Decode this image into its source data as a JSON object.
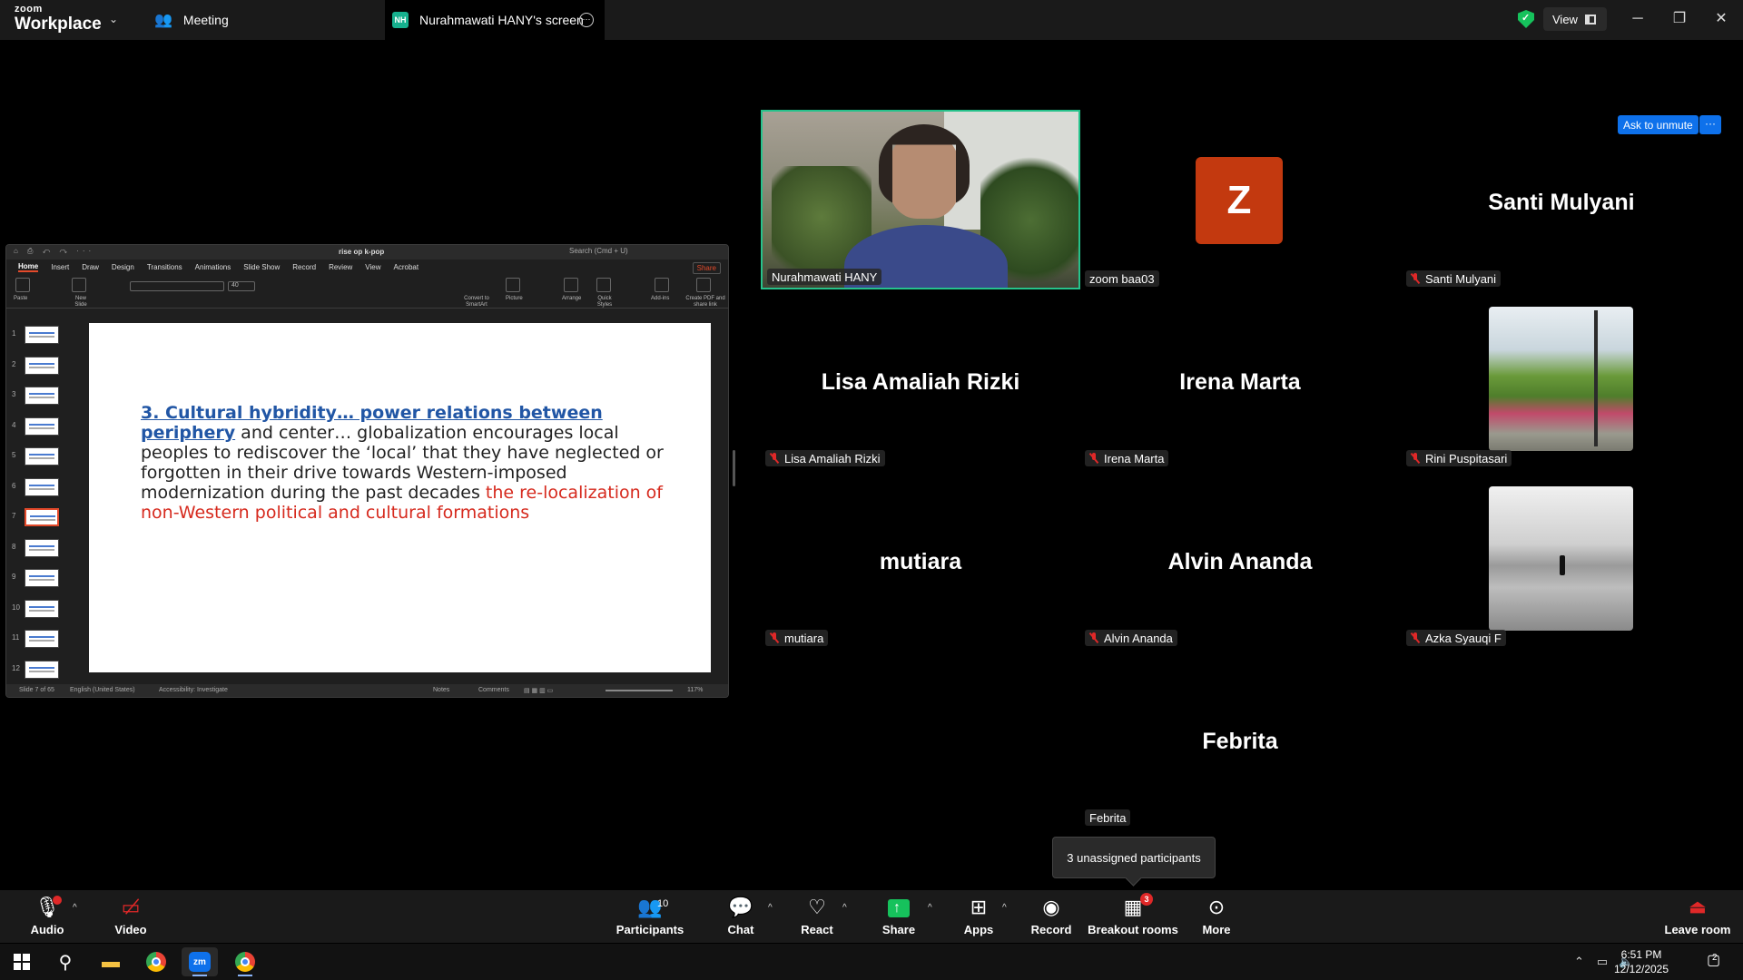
{
  "app": {
    "logo_line1": "zoom",
    "logo_line2": "Workplace",
    "meeting_tab": "Meeting",
    "share_tab": "Nurahmawati HANY's screen",
    "share_tab_initials": "NH",
    "view_label": "View",
    "accent": "#0e71eb",
    "speaker_border": "#26c28b"
  },
  "ppt": {
    "file_name": "rise op k-pop",
    "search_placeholder": "Search (Cmd + U)",
    "menu": [
      "Home",
      "Insert",
      "Draw",
      "Design",
      "Transitions",
      "Animations",
      "Slide Show",
      "Record",
      "Review",
      "View",
      "Acrobat"
    ],
    "share_label": "Share",
    "ribbon": {
      "paste": "Paste",
      "new_slide": "New Slide",
      "font_size": "40",
      "convert_smartart": "Convert to SmartArt",
      "picture": "Picture",
      "arrange": "Arrange",
      "quick_styles": "Quick Styles",
      "add_ins": "Add-ins",
      "create_pdf": "Create PDF and share link"
    },
    "thumb_numbers": [
      "1",
      "2",
      "3",
      "4",
      "5",
      "6",
      "7",
      "8",
      "9",
      "10",
      "11",
      "12"
    ],
    "selected_slide": 7,
    "slide": {
      "heading": "3. Cultural hybridity… power relations between periphery",
      "body": " and center… globalization encourages local peoples to rediscover the ‘local’ that they have neglected or forgotten in their drive towards Western-imposed modernization during the past decades ",
      "red_text": "the re-localization of non-Western political and cultural formations"
    },
    "status": {
      "slide_count": "Slide 7 of 65",
      "language": "English (United States)",
      "accessibility": "Accessibility: Investigate",
      "notes": "Notes",
      "comments": "Comments",
      "zoom": "117%"
    }
  },
  "gallery": {
    "ask_to_unmute": "Ask to unmute",
    "more_label": "···",
    "tiles": [
      {
        "label": "Nurahmawati HANY",
        "muted": false
      },
      {
        "label": "zoom baa03",
        "avatar": "Z",
        "muted": false
      },
      {
        "label": "Santi Mulyani",
        "big": "Santi Mulyani",
        "muted": true
      },
      {
        "label": "Lisa Amaliah Rizki",
        "big": "Lisa Amaliah Rizki",
        "muted": true
      },
      {
        "label": "Irena Marta",
        "big": "Irena Marta",
        "muted": true
      },
      {
        "label": "Rini Puspitasari",
        "muted": true
      },
      {
        "label": "mutiara",
        "big": "mutiara",
        "muted": true
      },
      {
        "label": "Alvin Ananda",
        "big": "Alvin Ananda",
        "muted": true
      },
      {
        "label": "Azka Syauqi F",
        "muted": true
      },
      {
        "label": "Febrita",
        "big": "Febrita",
        "muted": false
      }
    ],
    "unassigned_tooltip": "3 unassigned participants"
  },
  "toolbar": {
    "audio": "Audio",
    "video": "Video",
    "participants": "Participants",
    "participants_count": "10",
    "chat": "Chat",
    "react": "React",
    "share": "Share",
    "apps": "Apps",
    "record": "Record",
    "breakout": "Breakout rooms",
    "breakout_badge": "3",
    "more": "More",
    "leave": "Leave room"
  },
  "taskbar": {
    "time": "6:51 PM",
    "date": "12/12/2025",
    "notif_count": "2",
    "zoom_task": "zm"
  }
}
